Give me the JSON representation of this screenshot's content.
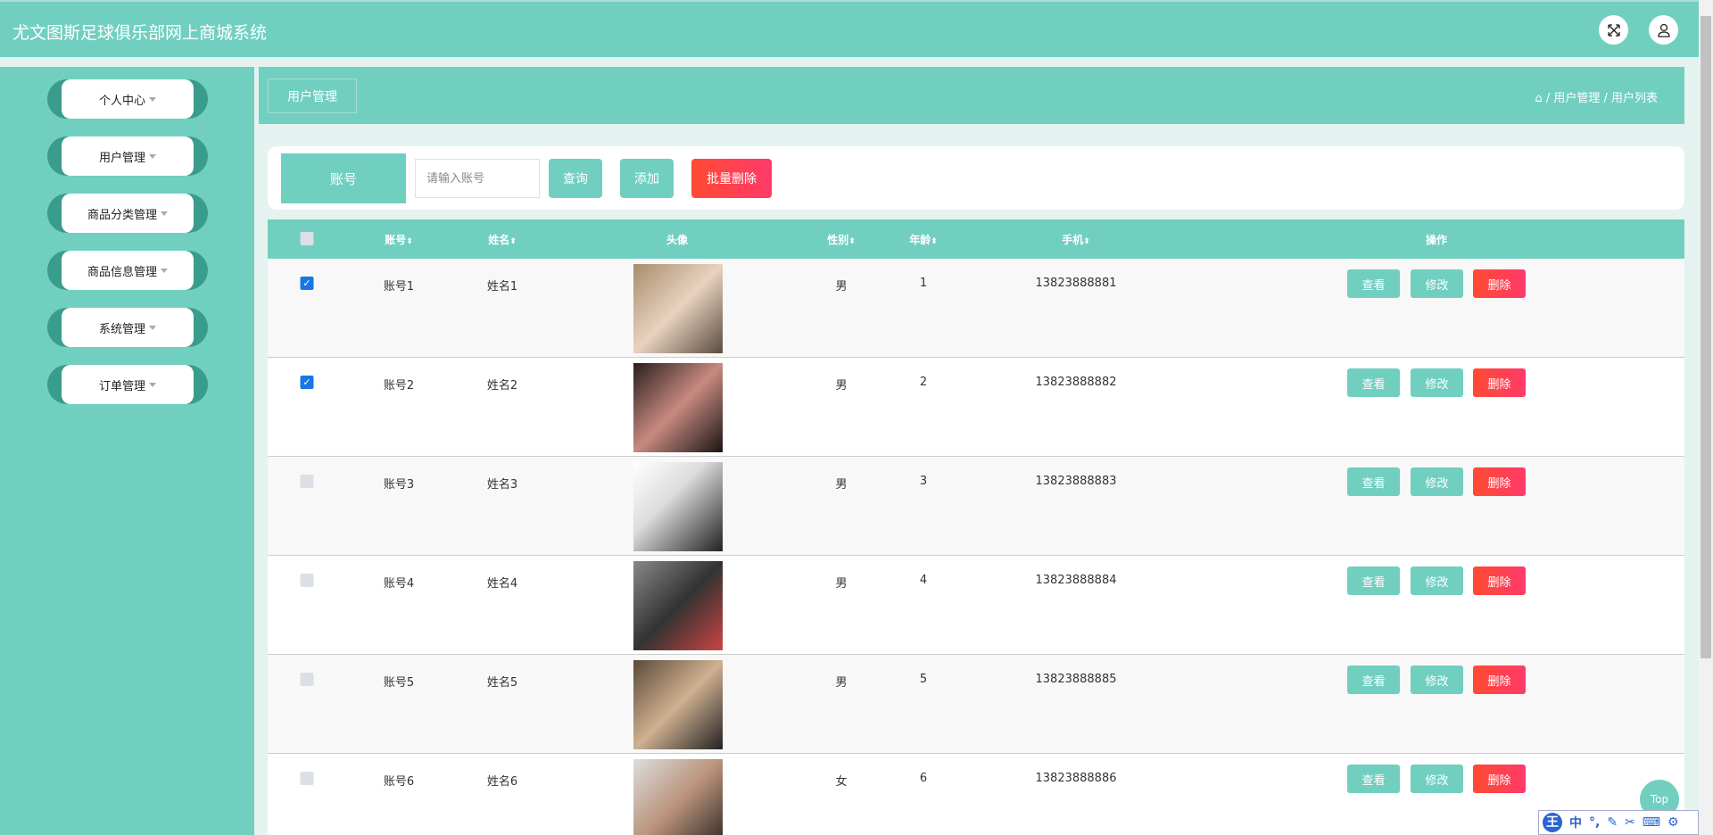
{
  "header": {
    "title": "尤文图斯足球俱乐部网上商城系统",
    "icons": [
      "fullscreen-icon",
      "user-icon"
    ]
  },
  "sidebar": {
    "items": [
      {
        "label": "个人中心"
      },
      {
        "label": "用户管理"
      },
      {
        "label": "商品分类管理"
      },
      {
        "label": "商品信息管理"
      },
      {
        "label": "系统管理"
      },
      {
        "label": "订单管理"
      }
    ]
  },
  "breadcrumb": {
    "tag": "用户管理",
    "path": "/ 用户管理 / 用户列表"
  },
  "search": {
    "label": "账号",
    "placeholder": "请输入账号",
    "query": "查询",
    "add": "添加",
    "batch_delete": "批量删除"
  },
  "table": {
    "headers": [
      "账号",
      "姓名",
      "头像",
      "性别",
      "年龄",
      "手机",
      "操作"
    ],
    "rows": [
      {
        "account": "账号1",
        "name": "姓名1",
        "gender": "男",
        "age": "1",
        "phone": "13823888881",
        "checked": true
      },
      {
        "account": "账号2",
        "name": "姓名2",
        "gender": "男",
        "age": "2",
        "phone": "13823888882",
        "checked": true
      },
      {
        "account": "账号3",
        "name": "姓名3",
        "gender": "男",
        "age": "3",
        "phone": "13823888883",
        "checked": false
      },
      {
        "account": "账号4",
        "name": "姓名4",
        "gender": "男",
        "age": "4",
        "phone": "13823888884",
        "checked": false
      },
      {
        "account": "账号5",
        "name": "姓名5",
        "gender": "男",
        "age": "5",
        "phone": "13823888885",
        "checked": false
      },
      {
        "account": "账号6",
        "name": "姓名6",
        "gender": "女",
        "age": "6",
        "phone": "13823888886",
        "checked": false
      }
    ],
    "actions": {
      "view": "查看",
      "edit": "修改",
      "delete": "删除"
    }
  },
  "top_button": "Top",
  "ime": {
    "logo": "王",
    "mode": "中"
  },
  "colors": {
    "primary": "#71cfc0",
    "danger": "#ff4a32"
  }
}
